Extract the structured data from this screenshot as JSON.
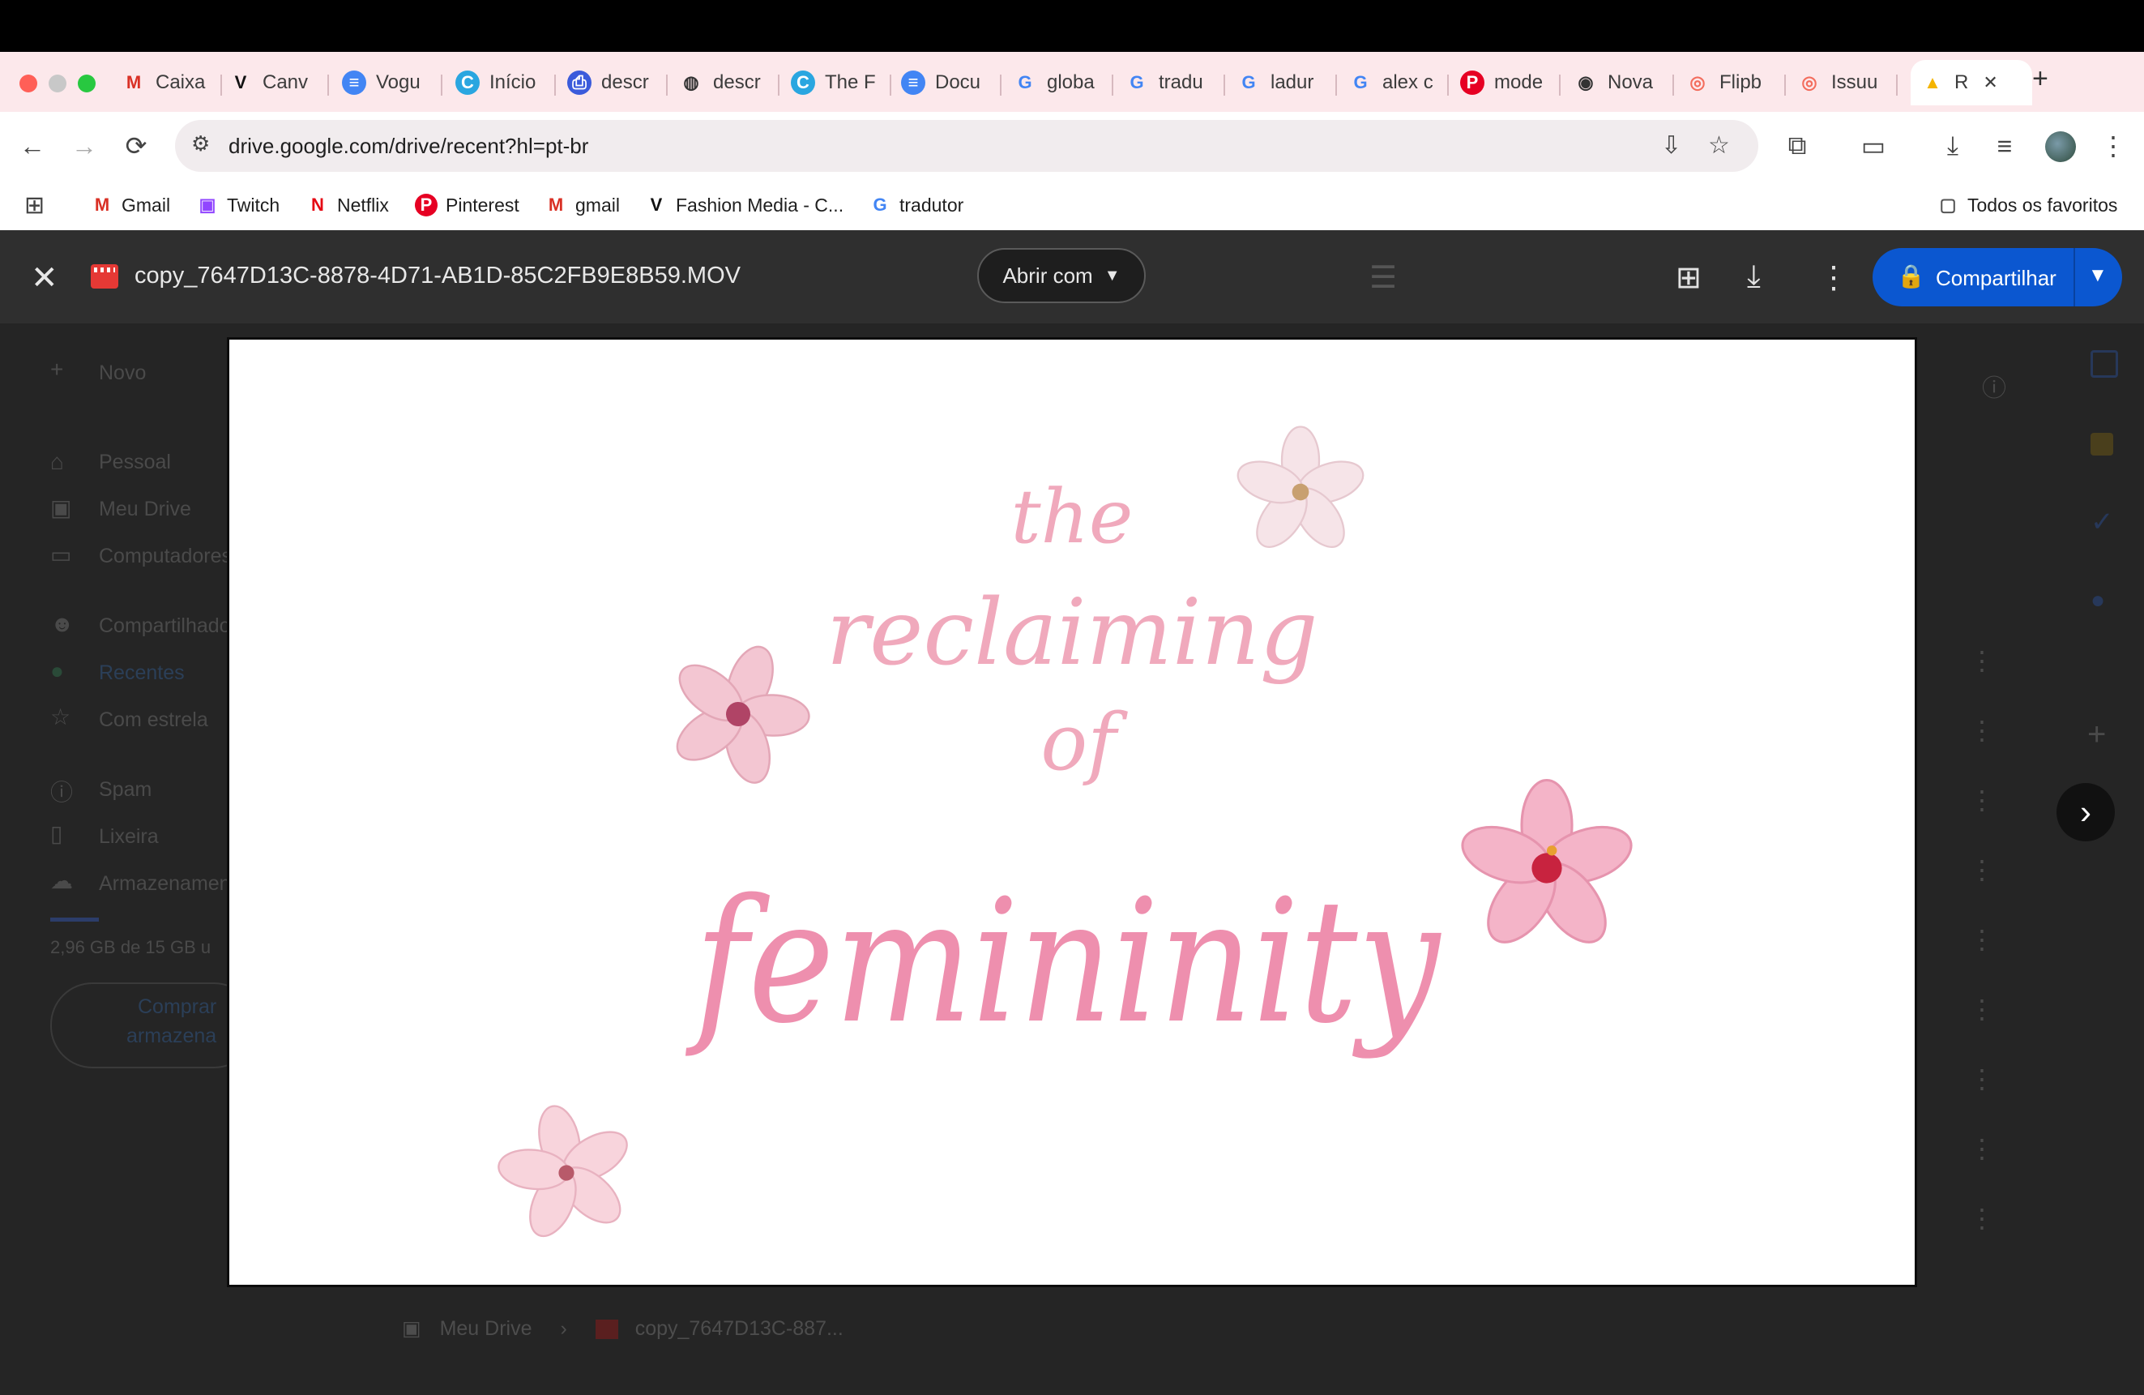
{
  "browser": {
    "tabs": [
      {
        "label": "Caixa",
        "icon": "gmail-icon"
      },
      {
        "label": "Canv",
        "icon": "vogue-v-icon"
      },
      {
        "label": "Vogu",
        "icon": "docs-icon"
      },
      {
        "label": "Início",
        "icon": "canva-icon"
      },
      {
        "label": "descr",
        "icon": "printer-icon"
      },
      {
        "label": "descr",
        "icon": "globe-icon"
      },
      {
        "label": "The F",
        "icon": "canva-icon"
      },
      {
        "label": "Docu",
        "icon": "docs-icon"
      },
      {
        "label": "globa",
        "icon": "google-icon"
      },
      {
        "label": "tradu",
        "icon": "google-icon"
      },
      {
        "label": "ladur",
        "icon": "google-icon"
      },
      {
        "label": "alex c",
        "icon": "google-icon"
      },
      {
        "label": "mode",
        "icon": "pinterest-icon"
      },
      {
        "label": "Nova",
        "icon": "chrome-icon"
      },
      {
        "label": "Flipb",
        "icon": "issuu-icon"
      },
      {
        "label": "Issuu",
        "icon": "issuu-icon"
      },
      {
        "label": "R",
        "icon": "drive-icon"
      }
    ],
    "url": "drive.google.com/drive/recent?hl=pt-br",
    "bookmarks": [
      {
        "label": "Gmail",
        "icon": "gmail-icon"
      },
      {
        "label": "Twitch",
        "icon": "twitch-icon"
      },
      {
        "label": "Netflix",
        "icon": "netflix-icon"
      },
      {
        "label": "Pinterest",
        "icon": "pinterest-icon"
      },
      {
        "label": "gmail",
        "icon": "gmail-icon"
      },
      {
        "label": "Fashion Media - C...",
        "icon": "vogue-v-icon"
      },
      {
        "label": "tradutor",
        "icon": "google-icon"
      }
    ],
    "all_bookmarks": "Todos os favoritos"
  },
  "viewer": {
    "filename": "copy_7647D13C-8878-4D71-AB1D-85C2FB9E8B59.MOV",
    "open_with": "Abrir com",
    "share": "Compartilhar"
  },
  "sidebar": {
    "new": "Novo",
    "items": [
      "Pessoal",
      "Meu Drive",
      "Computadores",
      "Compartilhados",
      "Recentes",
      "Com estrela",
      "Spam",
      "Lixeira",
      "Armazenamento"
    ],
    "storage": "2,96 GB de 15 GB u",
    "buy": [
      "Comprar",
      "armazena"
    ]
  },
  "media": {
    "line1": "the",
    "line2": "reclaiming",
    "line3": "of",
    "line4": "femininity"
  },
  "breadcrumb": {
    "root": "Meu Drive",
    "file": "copy_7647D13C-887..."
  },
  "colors": {
    "accent": "#0b57d0",
    "tab_bg": "#fce8eb",
    "script_pink": "#ee8fae"
  }
}
